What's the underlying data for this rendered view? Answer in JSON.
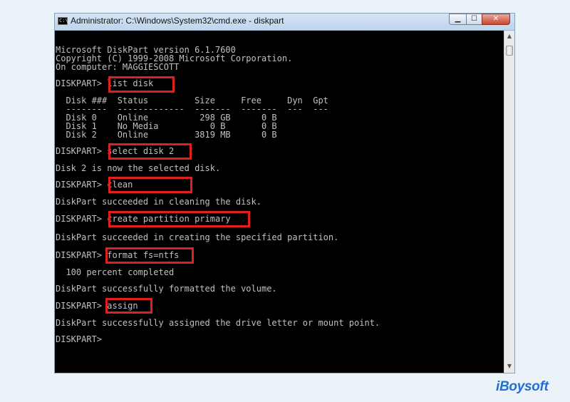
{
  "window": {
    "title": "Administrator: C:\\Windows\\System32\\cmd.exe - diskpart",
    "minimize": "▁",
    "maximize": "☐",
    "close": "✕"
  },
  "console": {
    "lines": {
      "header1": "Microsoft DiskPart version 6.1.7600",
      "header2": "Copyright (C) 1999-2008 Microsoft Corporation.",
      "header3": "On computer: MAGGIESCOTT",
      "prompt1": "DISKPART> list disk",
      "table_head": "  Disk ###  Status         Size     Free     Dyn  Gpt",
      "table_rule": "  --------  -------------  -------  -------  ---  ---",
      "disk0": "  Disk 0    Online          298 GB      0 B",
      "disk1": "  Disk 1    No Media          0 B       0 B",
      "disk2": "  Disk 2    Online         3819 MB      0 B",
      "prompt2": "DISKPART> select disk 2",
      "out2": "Disk 2 is now the selected disk.",
      "prompt3": "DISKPART> clean",
      "out3": "DiskPart succeeded in cleaning the disk.",
      "prompt4": "DISKPART> create partition primary",
      "out4": "DiskPart succeeded in creating the specified partition.",
      "prompt5": "DISKPART> format fs=ntfs",
      "out5a": "  100 percent completed",
      "out5b": "DiskPart successfully formatted the volume.",
      "prompt6": "DISKPART> assign",
      "out6": "DiskPart successfully assigned the drive letter or mount point.",
      "prompt7": "DISKPART>"
    }
  },
  "logo": {
    "text": "iBoysoft"
  },
  "colors": {
    "highlight": "#e0201c",
    "console_text": "#c0c0c0",
    "logo": "#1f6fd6"
  }
}
